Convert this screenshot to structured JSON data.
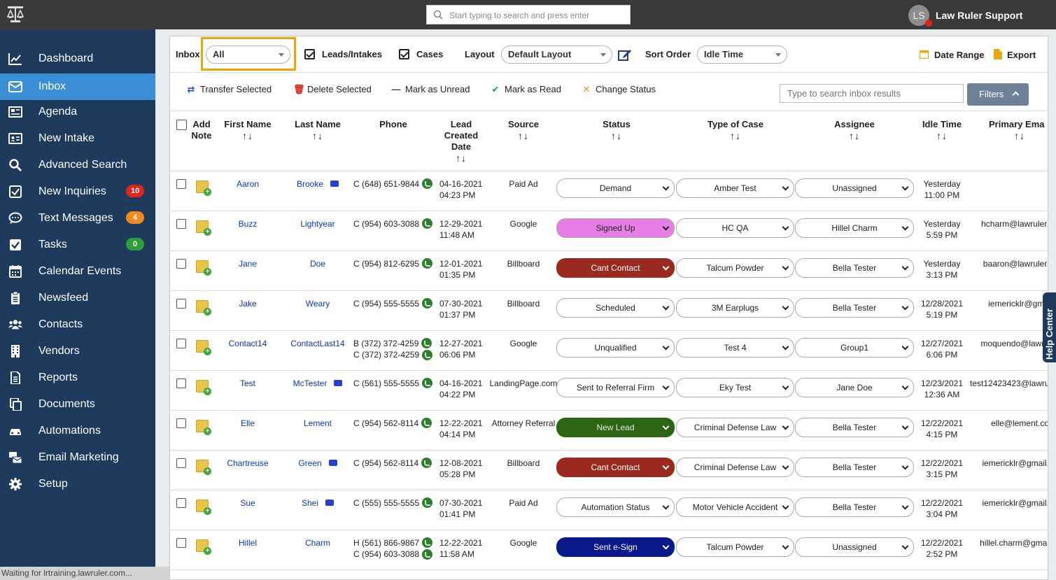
{
  "topbar": {
    "search_placeholder": "Start typing to search and press enter",
    "user_initials": "LS",
    "user_name": "Law Ruler Support"
  },
  "sidebar": {
    "items": [
      {
        "label": "Dashboard",
        "icon": "chart-line-icon"
      },
      {
        "label": "Inbox",
        "icon": "envelope-icon",
        "active": true
      },
      {
        "label": "Agenda",
        "icon": "newspaper-icon"
      },
      {
        "label": "New Intake",
        "icon": "id-card-icon"
      },
      {
        "label": "Advanced Search",
        "icon": "search-icon"
      },
      {
        "label": "New Inquiries",
        "icon": "check-square-icon",
        "badge": "10",
        "badge_color": "#e0261b"
      },
      {
        "label": "Text Messages",
        "icon": "chat-bubble-icon",
        "badge": "4",
        "badge_color": "#f08c1c"
      },
      {
        "label": "Tasks",
        "icon": "checkbox-icon",
        "badge": "0",
        "badge_color": "#2e9c3a"
      },
      {
        "label": "Calendar Events",
        "icon": "calendar-icon"
      },
      {
        "label": "Newsfeed",
        "icon": "clipboard-icon"
      },
      {
        "label": "Contacts",
        "icon": "users-icon"
      },
      {
        "label": "Vendors",
        "icon": "building-icon"
      },
      {
        "label": "Reports",
        "icon": "file-text-icon"
      },
      {
        "label": "Documents",
        "icon": "copy-icon"
      },
      {
        "label": "Automations",
        "icon": "car-icon"
      },
      {
        "label": "Email Marketing",
        "icon": "mail-bulk-icon"
      },
      {
        "label": "Setup",
        "icon": "gear-icon"
      }
    ]
  },
  "status_bar": "Waiting for lrtraining.lawruler.com...",
  "toolbar": {
    "inbox_label": "Inbox",
    "inbox_value": "All",
    "leads_label": "Leads/Intakes",
    "cases_label": "Cases",
    "layout_label": "Layout",
    "layout_value": "Default Layout",
    "sort_label": "Sort Order",
    "sort_value": "Idle Time",
    "date_range": "Date Range",
    "export": "Export"
  },
  "actions": {
    "transfer": "Transfer Selected",
    "delete": "Delete Selected",
    "unread": "Mark as Unread",
    "read": "Mark as Read",
    "change_status": "Change Status",
    "search_placeholder": "Type to search inbox results",
    "filters": "Filters"
  },
  "columns": {
    "add_note": "Add Note",
    "first_name": "First Name",
    "last_name": "Last Name",
    "phone": "Phone",
    "lead_created": "Lead Created Date",
    "source": "Source",
    "status": "Status",
    "type_of_case": "Type of Case",
    "assignee": "Assignee",
    "idle_time": "Idle Time",
    "primary_email": "Primary Ema",
    "sort_glyph": "↑↓"
  },
  "rows": [
    {
      "first": "Aaron",
      "last": "Brooke",
      "case_icon": true,
      "phones": [
        "C (648) 651-9844"
      ],
      "date": "04-16-2021",
      "time": "04:23 PM",
      "source": "Paid Ad",
      "status": "Demand",
      "status_bg": "#ffffff",
      "status_fg": "#222222",
      "case_type": "Amber Test",
      "assignee": "Unassigned",
      "idle1": "Yesterday",
      "idle2": "11:00 PM",
      "email": ""
    },
    {
      "first": "Buzz",
      "last": "Lightyear",
      "case_icon": false,
      "phones": [
        "C (954) 603-3088"
      ],
      "date": "12-29-2021",
      "time": "11:48 AM",
      "source": "Google",
      "status": "Signed Up",
      "status_bg": "#e77ee6",
      "status_fg": "#222222",
      "case_type": "HC QA",
      "assignee": "Hillel Charm",
      "idle1": "Yesterday",
      "idle2": "5:59 PM",
      "email": "hcharm@lawruler."
    },
    {
      "first": "Jane",
      "last": "Doe",
      "case_icon": false,
      "phones": [
        "C (954) 812-6295"
      ],
      "date": "12-01-2021",
      "time": "01:35 PM",
      "source": "Billboard",
      "status": "Cant Contact",
      "status_bg": "#9a2a20",
      "status_fg": "#ffffff",
      "case_type": "Talcum Powder",
      "assignee": "Bella Tester",
      "idle1": "Yesterday",
      "idle2": "3:13 PM",
      "email": "baaron@lawruler."
    },
    {
      "first": "Jake",
      "last": "Weary",
      "case_icon": false,
      "phones": [
        "C (954) 555-5555"
      ],
      "date": "07-30-2021",
      "time": "01:37 PM",
      "source": "Billboard",
      "status": "Scheduled",
      "status_bg": "#ffffff",
      "status_fg": "#222222",
      "case_type": "3M Earplugs",
      "assignee": "Bella Tester",
      "idle1": "12/28/2021",
      "idle2": "5:19 PM",
      "email": "iemericklr@gma"
    },
    {
      "first": "Contact14",
      "last": "ContactLast14",
      "case_icon": false,
      "phones": [
        "B (372) 372-4259",
        "C (372) 372-4259"
      ],
      "date": "12-27-2021",
      "time": "06:06 PM",
      "source": "Google",
      "status": "Unqualified",
      "status_bg": "#ffffff",
      "status_fg": "#222222",
      "case_type": "Test 4",
      "assignee": "Group1",
      "idle1": "12/27/2021",
      "idle2": "6:06 PM",
      "email": "moquendo@lawru"
    },
    {
      "first": "Test",
      "last": "McTester",
      "case_icon": true,
      "phones": [
        "C (561) 555-5555"
      ],
      "date": "04-16-2021",
      "time": "04:22 PM",
      "source": "LandingPage.com",
      "status": "Sent to Referral Firm",
      "status_bg": "#ffffff",
      "status_fg": "#222222",
      "case_type": "Eky Test",
      "assignee": "Jane Doe",
      "idle1": "12/23/2021",
      "idle2": "12:36 AM",
      "email": "test12423423@lawru"
    },
    {
      "first": "Elle",
      "last": "Lement",
      "case_icon": false,
      "phones": [
        "C (954) 562-8114"
      ],
      "date": "12-22-2021",
      "time": "04:14 PM",
      "source": "Attorney Referral",
      "status": "New Lead",
      "status_bg": "#2c6612",
      "status_fg": "#e8e8e8",
      "case_type": "Criminal Defense Law",
      "assignee": "Bella Tester",
      "idle1": "12/22/2021",
      "idle2": "4:15 PM",
      "email": "elle@lement.co"
    },
    {
      "first": "Chartreuse",
      "last": "Green",
      "case_icon": true,
      "phones": [
        "C (954) 562-8114"
      ],
      "date": "12-08-2021",
      "time": "05:28 PM",
      "source": "Billboard",
      "status": "Cant Contact",
      "status_bg": "#9a2a20",
      "status_fg": "#ffffff",
      "case_type": "Criminal Defense Law",
      "assignee": "Bella Tester",
      "idle1": "12/22/2021",
      "idle2": "3:15 PM",
      "email": "iemericklr@gmail."
    },
    {
      "first": "Sue",
      "last": "Shei",
      "case_icon": true,
      "phones": [
        "C (555) 555-5555"
      ],
      "date": "07-30-2021",
      "time": "01:41 PM",
      "source": "Paid Ad",
      "status": "Automation Status",
      "status_bg": "#ffffff",
      "status_fg": "#222222",
      "case_type": "Motor Vehicle Accident",
      "assignee": "Bella Tester",
      "idle1": "12/22/2021",
      "idle2": "3:04 PM",
      "email": "iemericklr@gmail."
    },
    {
      "first": "Hillel",
      "last": "Charm",
      "case_icon": false,
      "phones": [
        "H (561) 866-9867",
        "C (954) 603-3088"
      ],
      "date": "12-22-2021",
      "time": "11:58 AM",
      "source": "Google",
      "status": "Sent e-Sign",
      "status_bg": "#0a1a8a",
      "status_fg": "#ffffff",
      "case_type": "Talcum Powder",
      "assignee": "Unassigned",
      "idle1": "12/22/2021",
      "idle2": "2:52 PM",
      "email": "hillel.charm@gmai"
    }
  ],
  "help_center": "Help Center"
}
